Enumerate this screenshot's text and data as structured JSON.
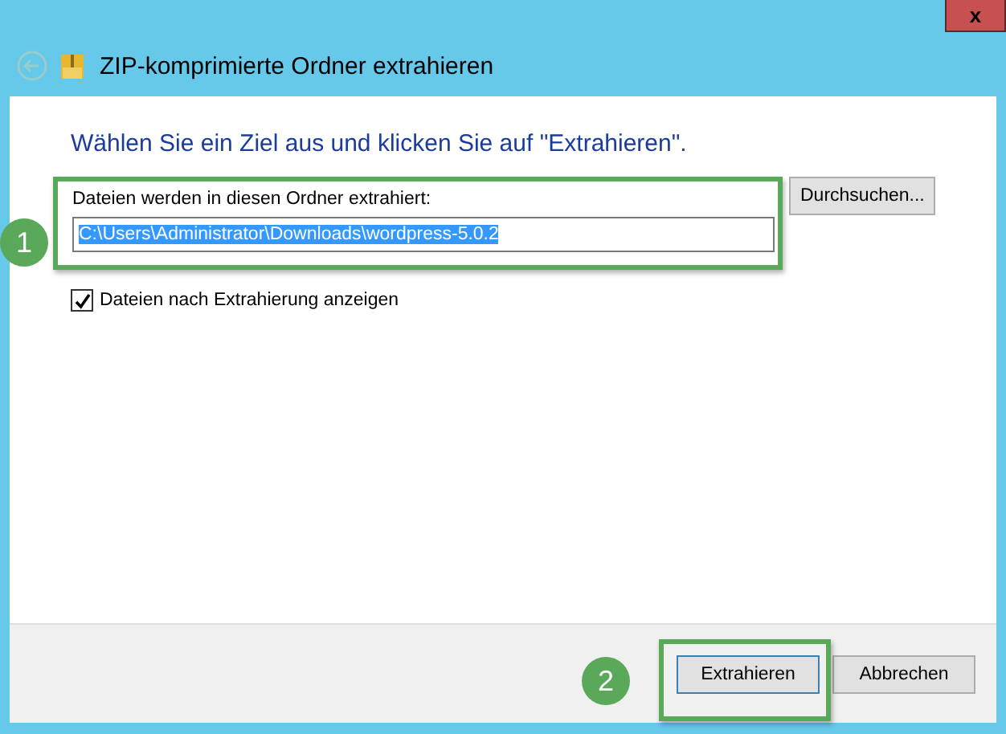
{
  "window": {
    "title": "ZIP-komprimierte Ordner extrahieren",
    "close_label": "x"
  },
  "heading": "Wählen Sie ein Ziel aus und klicken Sie auf \"Extrahieren\".",
  "destination": {
    "label": "Dateien werden in diesen Ordner extrahiert:",
    "value": "C:\\Users\\Administrator\\Downloads\\wordpress-5.0.2",
    "selected": true,
    "browse_button": "Durchsuchen..."
  },
  "show_files": {
    "label": "Dateien nach Extrahierung anzeigen",
    "checked": true
  },
  "buttons": [
    {
      "label": "Extrahieren",
      "default": true
    },
    {
      "label": "Abbrechen",
      "default": false
    }
  ],
  "annotations": [
    "1",
    "2"
  ]
}
